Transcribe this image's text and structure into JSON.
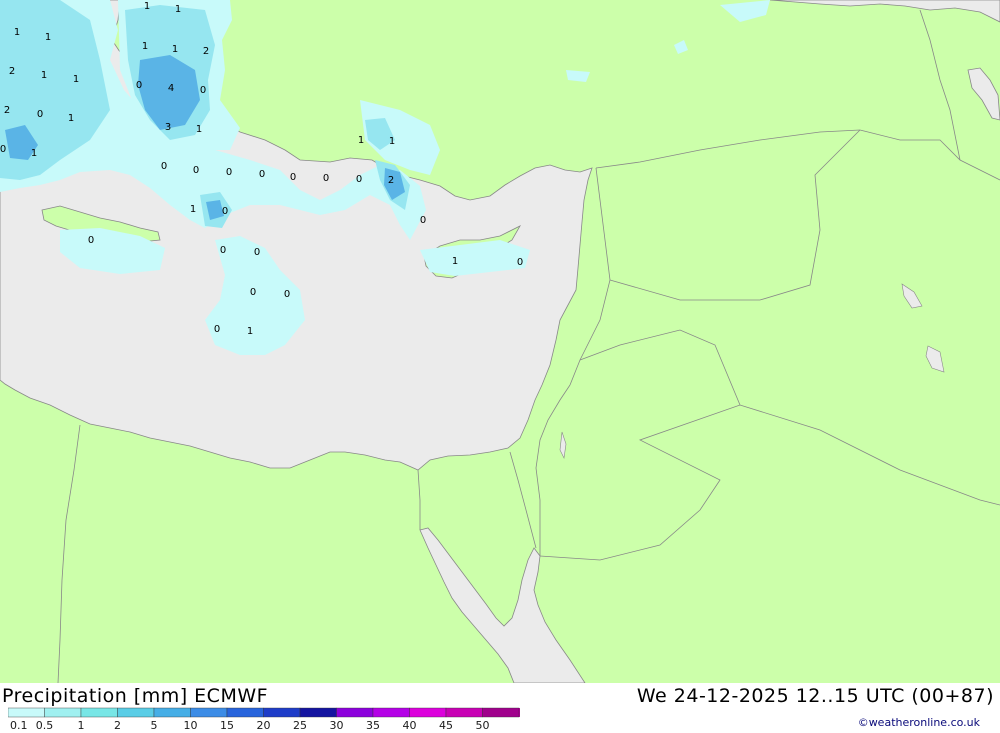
{
  "header": {
    "title": "Precipitation [mm] ECMWF",
    "datetime": "We 24-12-2025 12..15 UTC (00+87)",
    "credit": "©weatheronline.co.uk"
  },
  "legend": {
    "labels": [
      "0.1",
      "0.5",
      "1",
      "2",
      "5",
      "10",
      "15",
      "20",
      "25",
      "30",
      "35",
      "40",
      "45",
      "50"
    ],
    "colors": [
      "#c8fafa",
      "#a0f0f0",
      "#78e6e6",
      "#5acde6",
      "#46aee6",
      "#3c8ce6",
      "#2864dc",
      "#1e3cc8",
      "#1414a0",
      "#8c00dc",
      "#b400e6",
      "#dc00dc",
      "#c800b4",
      "#a0008c"
    ]
  },
  "colors": {
    "land": "#ccffaa",
    "sea": "#ebebeb",
    "border": "#888888",
    "precip_light": "#c8fafa",
    "precip_mid": "#96e6f0",
    "precip_heavy": "#5ab4e6"
  },
  "map_labels": [
    {
      "text": "1"
    },
    {
      "text": "1"
    },
    {
      "text": "1"
    },
    {
      "text": "1"
    },
    {
      "text": "1"
    },
    {
      "text": "1"
    },
    {
      "text": "2"
    },
    {
      "text": "2"
    },
    {
      "text": "1"
    },
    {
      "text": "1"
    },
    {
      "text": "0"
    },
    {
      "text": "4"
    },
    {
      "text": "0"
    },
    {
      "text": "2"
    },
    {
      "text": "0"
    },
    {
      "text": "1"
    },
    {
      "text": "3"
    },
    {
      "text": "1"
    },
    {
      "text": "0"
    },
    {
      "text": "1"
    },
    {
      "text": "0"
    },
    {
      "text": "0"
    },
    {
      "text": "0"
    },
    {
      "text": "0"
    },
    {
      "text": "0"
    },
    {
      "text": "0"
    },
    {
      "text": "0"
    },
    {
      "text": "1"
    },
    {
      "text": "2"
    },
    {
      "text": "1"
    },
    {
      "text": "1"
    },
    {
      "text": "0"
    },
    {
      "text": "0"
    },
    {
      "text": "0"
    },
    {
      "text": "1"
    },
    {
      "text": "0"
    },
    {
      "text": "0"
    },
    {
      "text": "0"
    },
    {
      "text": "0"
    },
    {
      "text": "0"
    },
    {
      "text": "0"
    },
    {
      "text": "1"
    }
  ]
}
